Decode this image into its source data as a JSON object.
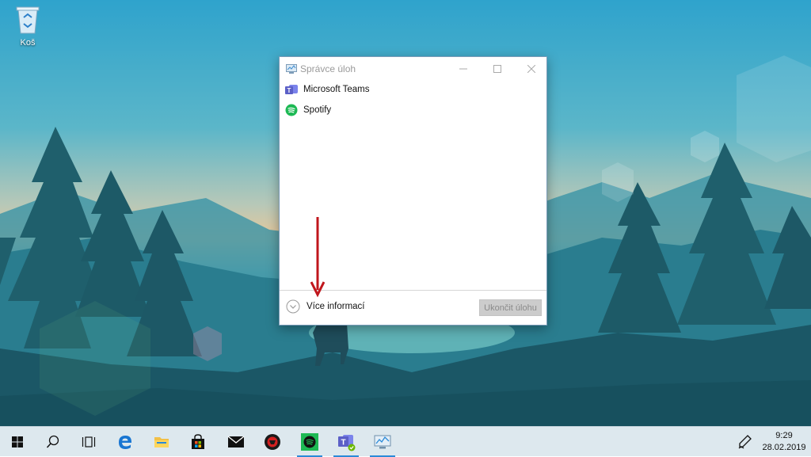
{
  "desktop": {
    "recycle_bin_label": "Koš"
  },
  "task_manager": {
    "title": "Správce úloh",
    "apps": [
      {
        "name": "Microsoft Teams",
        "icon": "teams-icon"
      },
      {
        "name": "Spotify",
        "icon": "spotify-icon"
      }
    ],
    "more_details_label": "Více informací",
    "end_task_label": "Ukončit úlohu"
  },
  "taskbar": {
    "items": [
      "start-icon",
      "search-icon",
      "task-view-icon",
      "edge-icon",
      "file-explorer-icon",
      "store-icon",
      "mail-icon",
      "game-app-icon",
      "spotify-icon",
      "teams-icon",
      "task-manager-icon"
    ],
    "time": "9:29",
    "date": "28.02.2019"
  },
  "colors": {
    "taskbar_bg": "#dde8ee",
    "accent": "#2b8ad8",
    "arrow": "#c0161c",
    "spotify": "#1db954",
    "teams": "#5b5fc7"
  }
}
